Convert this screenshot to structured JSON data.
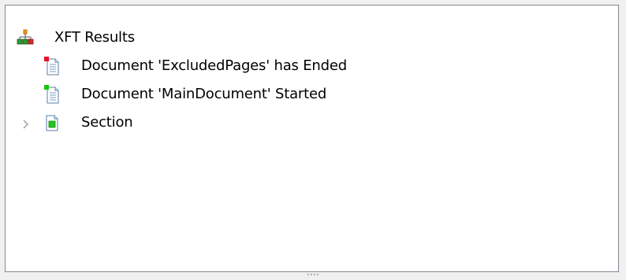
{
  "tree": {
    "root": {
      "label": "XFT Results",
      "icon": "hierarchy-icon"
    },
    "items": [
      {
        "label": "Document 'ExcludedPages' has Ended",
        "icon": "document-ended-icon",
        "marker_color": "#e81123"
      },
      {
        "label": "Document 'MainDocument' Started",
        "icon": "document-started-icon",
        "marker_color": "#16c60c"
      },
      {
        "label": "Section",
        "icon": "section-icon",
        "expanded": false
      }
    ]
  },
  "colors": {
    "panel_border": "#828790",
    "background": "#ffffff",
    "section_fill": "#22c522"
  }
}
